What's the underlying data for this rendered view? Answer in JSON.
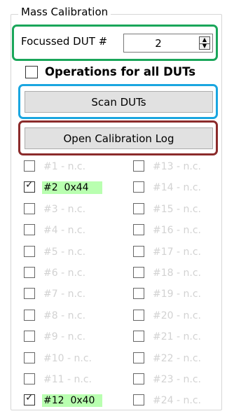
{
  "group_title": "Mass Calibration",
  "focused": {
    "label": "Focussed DUT #",
    "value": "2"
  },
  "operations_all": {
    "label": "Operations for all DUTs",
    "checked": false
  },
  "buttons": {
    "scan": "Scan DUTs",
    "open_log": "Open Calibration Log"
  },
  "highlight_colors": {
    "green": "#1aa65a",
    "blue": "#1aa6e0",
    "red": "#8b2b2b"
  },
  "found_color": "#b9ffb0",
  "duts": [
    {
      "label": "#1 - n.c.",
      "checked": false,
      "found": false
    },
    {
      "label": "#2  0x44",
      "checked": true,
      "found": true
    },
    {
      "label": "#3 - n.c.",
      "checked": false,
      "found": false
    },
    {
      "label": "#4 - n.c.",
      "checked": false,
      "found": false
    },
    {
      "label": "#5 - n.c.",
      "checked": false,
      "found": false
    },
    {
      "label": "#6 - n.c.",
      "checked": false,
      "found": false
    },
    {
      "label": "#7 - n.c.",
      "checked": false,
      "found": false
    },
    {
      "label": "#8 - n.c.",
      "checked": false,
      "found": false
    },
    {
      "label": "#9 - n.c.",
      "checked": false,
      "found": false
    },
    {
      "label": "#10 - n.c.",
      "checked": false,
      "found": false
    },
    {
      "label": "#11 - n.c.",
      "checked": false,
      "found": false
    },
    {
      "label": "#12  0x40",
      "checked": true,
      "found": true
    },
    {
      "label": "#13 - n.c.",
      "checked": false,
      "found": false
    },
    {
      "label": "#14 - n.c.",
      "checked": false,
      "found": false
    },
    {
      "label": "#15 - n.c.",
      "checked": false,
      "found": false
    },
    {
      "label": "#16 - n.c.",
      "checked": false,
      "found": false
    },
    {
      "label": "#17 - n.c.",
      "checked": false,
      "found": false
    },
    {
      "label": "#18 - n.c.",
      "checked": false,
      "found": false
    },
    {
      "label": "#19 - n.c.",
      "checked": false,
      "found": false
    },
    {
      "label": "#20 - n.c.",
      "checked": false,
      "found": false
    },
    {
      "label": "#21 - n.c.",
      "checked": false,
      "found": false
    },
    {
      "label": "#22 - n.c.",
      "checked": false,
      "found": false
    },
    {
      "label": "#23 - n.c.",
      "checked": false,
      "found": false
    },
    {
      "label": "#24 - n.c.",
      "checked": false,
      "found": false
    }
  ]
}
